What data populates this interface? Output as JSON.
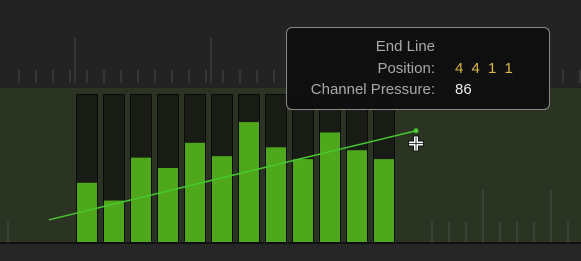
{
  "editor": {
    "lane_color": "#2b3323",
    "bar_fill_color": "#4fa81c",
    "line_color": "#46c82e",
    "velocities": [
      0.4,
      0.28,
      0.57,
      0.5,
      0.67,
      0.58,
      0.81,
      0.64,
      0.56,
      0.74,
      0.62,
      0.56
    ],
    "line_start_value": 0.15,
    "line_end_value": 0.86
  },
  "tooltip": {
    "title": "End Line",
    "position_label": "Position:",
    "position_value": "4 4 1 1",
    "pressure_label": "Channel Pressure:",
    "pressure_value": "86"
  },
  "cursor": {
    "icon": "crosshair-icon"
  }
}
